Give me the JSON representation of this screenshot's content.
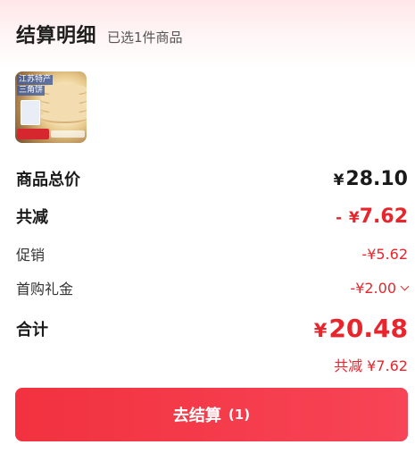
{
  "header": {
    "title": "结算明细",
    "subtitle": "已选1件商品"
  },
  "product": {
    "thumbnail_tag1": "江苏特产",
    "thumbnail_tag2": "三角饼"
  },
  "summary": {
    "total_label": "商品总价",
    "total_currency": "¥",
    "total_value": "28.10",
    "discount_label": "共减",
    "discount_prefix": "-",
    "discount_currency": "¥",
    "discount_value": "7.62",
    "promo_label": "促销",
    "promo_value": "-¥5.62",
    "first_purchase_label": "首购礼金",
    "first_purchase_value": "-¥2.00",
    "sum_label": "合计",
    "sum_currency": "¥",
    "sum_value": "20.48",
    "saving_text": "共减 ¥7.62"
  },
  "checkout": {
    "label": "去结算",
    "count": "(1)"
  },
  "colors": {
    "accent": "#e8252c",
    "button": "#f2323f"
  }
}
